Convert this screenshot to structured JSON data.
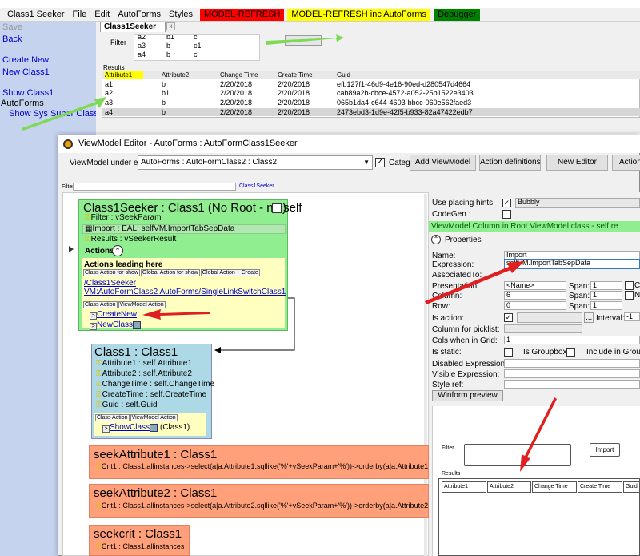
{
  "menubar": {
    "items": [
      "Class1 Seeker",
      "File",
      "Edit",
      "AutoForms",
      "Styles"
    ],
    "model_refresh": "MODEL-REFRESH",
    "model_refresh_inc": "MODEL-REFRESH inc AutoForms",
    "debugger": "Debugger"
  },
  "sidebar": {
    "save": "Save",
    "back": "Back",
    "create_new": "Create New",
    "new_class1": "New Class1",
    "show_class1": "Show Class1",
    "autoforms": "AutoForms",
    "show_sys": "Show Sys Super Class"
  },
  "seeker": {
    "tab": "Class1Seeker",
    "tab_close": "x",
    "filter_label": "Filter",
    "filter_rows": [
      [
        "a2",
        "b1",
        "c"
      ],
      [
        "a3",
        "b",
        "c1"
      ],
      [
        "a4",
        "b",
        "c"
      ]
    ],
    "results_label": "Results",
    "columns": [
      "Attribute1",
      "Attribute2",
      "Change Time",
      "Create Time",
      "Guid"
    ],
    "rows": [
      [
        "a1",
        "b",
        "2/20/2018",
        "2/20/2018",
        "efb127f1-46d9-4e16-90ed-d280547d4664"
      ],
      [
        "a2",
        "b1",
        "2/20/2018",
        "2/20/2018",
        "cab89a2b-cbce-4572-a052-25b1522e3403"
      ],
      [
        "a3",
        "b",
        "2/20/2018",
        "2/20/2018",
        "065b1da4-c644-4603-bbcc-060e562faed3"
      ],
      [
        "a4",
        "b",
        "2/20/2018",
        "2/20/2018",
        "2473ebd3-1d9e-42f5-b933-82a47422edb7"
      ]
    ]
  },
  "editor": {
    "title": "ViewModel Editor - AutoForms : AutoFormClass1Seeker",
    "vm_under_edit_label": "ViewModel under edit:",
    "vm_under_edit_value": "AutoForms : AutoFormClass2 : Class2",
    "categ_label": "Categ",
    "categ_checked": "✓",
    "buttons": [
      "Add ViewModel",
      "Action definitions",
      "New Editor",
      "Action"
    ],
    "filter_label": "Filter:",
    "filter_link": "Class1Seeker"
  },
  "canvas": {
    "root": {
      "title": "Class1Seeker : Class1  (No Root - no self",
      "title_end": ")",
      "filter": "Filter : vSeekParam",
      "import": "Import : EAL: selfVM.ImportTabSepData",
      "results": "Results : vSeekerResult",
      "actions_label": "Actions",
      "actions_leading": "Actions leading here",
      "leading_buttons": [
        "Class Action for show",
        "Global Action for show",
        "Global Action + Create"
      ],
      "leading_links": [
        "/Class1Seeker",
        "VM:AutoFormClass2 AutoForms/SingleLinkSwitchClass1"
      ],
      "action_buttons": [
        "Class Action",
        "ViewModel Action"
      ],
      "create_new": "CreateNew",
      "new_class1": "NewClass1"
    },
    "class1": {
      "title": "Class1 : Class1",
      "attrs": [
        "Attribute1 : self.Attribute1",
        "Attribute2 : self.Attribute2",
        "ChangeTime : self.ChangeTime",
        "CreateTime : self.CreateTime",
        "Guid : self.Guid"
      ],
      "action_buttons": [
        "Class Action",
        "ViewModel Action"
      ],
      "show_class1": "ShowClass1",
      "show_class1_suffix": "(Class1)"
    },
    "seek1": {
      "title": "seekAttribute1 : Class1",
      "crit": "Crit1 : Class1.allinstances->select(a|a.Attribute1.sqllike('%'+vSeekParam+'%'))->orderby(a|a.Attribute1"
    },
    "seek2": {
      "title": "seekAttribute2 : Class1",
      "crit": "Crit1 : Class1.allinstances->select(a|a.Attribute2.sqllike('%'+vSeekParam+'%'))->orderby(a|a.Attribute2"
    },
    "seekcrit": {
      "title": "seekcrit : Class1",
      "crit": "Crit1 : Class1.allinstances"
    }
  },
  "props": {
    "use_placing_hints": "Use placing hints:",
    "placing_value": "Bubbly",
    "codegen": "CodeGen :",
    "header": "ViewModel Column in Root ViewModel class - self re",
    "properties": "Properties",
    "name_label": "Name:",
    "name_value": "Import",
    "expression_label": "Expression:",
    "expression_value": "selfVM.ImportTabSepData",
    "associated_to": "AssociatedTo:",
    "presentation": "Presentation:",
    "presentation_value": "<Name>",
    "column": "Column:",
    "column_value": "6",
    "row": "Row:",
    "row_value": "0",
    "span": "Span:",
    "span_values": [
      "1",
      "1",
      "1"
    ],
    "is_action": "Is action:",
    "interval": "Interval:",
    "interval_value": "-1",
    "column_for_picklist": "Column for picklist:",
    "cols_when_in_grid": "Cols when in Grid:",
    "cols_value": "1",
    "is_static": "Is static:",
    "is_groupbox": "Is Groupbox:",
    "include_in_groupbox": "Include in Groupb",
    "disabled_expression": "Disabled Expression",
    "visible_expression": "Visible Expression:",
    "style_ref": "Style ref:",
    "winform_preview": "Winform preview",
    "side_letters": [
      "C",
      "N"
    ]
  },
  "preview": {
    "filter": "Filter",
    "import": "Import",
    "results": "Results",
    "columns": [
      "Attribute1",
      "Attribute2",
      "Change Time",
      "Create Time",
      "Guid"
    ]
  },
  "colors": {
    "sidebar": "#c5d3ef",
    "root_box": "#90ee90",
    "class_box": "#add8e6",
    "seek_box": "#ffa07a",
    "arrow_green": "#7ed957",
    "arrow_red": "#e02020"
  }
}
